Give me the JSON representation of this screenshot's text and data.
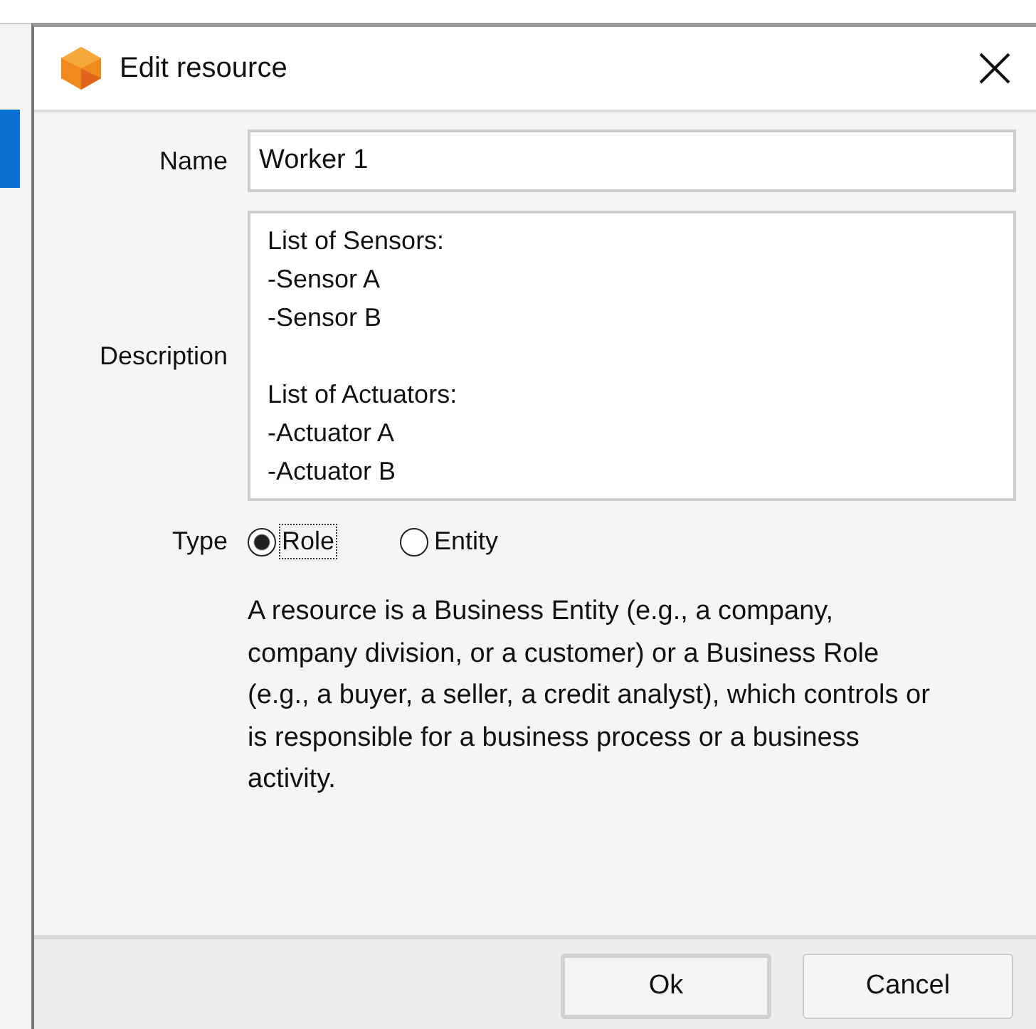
{
  "window": {
    "title": "Edit resource"
  },
  "name": {
    "label": "Name",
    "value": "Worker 1"
  },
  "description": {
    "label": "Description",
    "value": "List of Sensors:\n-Sensor A\n-Sensor B\n\nList of Actuators:\n-Actuator A\n-Actuator B"
  },
  "type": {
    "label": "Type",
    "options": [
      {
        "label": "Role",
        "selected": true
      },
      {
        "label": "Entity",
        "selected": false
      }
    ]
  },
  "help_text": "A resource is a Business Entity (e.g., a company, company division, or a customer) or a Business Role (e.g., a buyer, a seller, a credit analyst), which controls or is responsible for a business process or a business activity.",
  "buttons": [
    {
      "label": "Ok",
      "default": true
    },
    {
      "label": "Cancel",
      "default": false
    }
  ]
}
